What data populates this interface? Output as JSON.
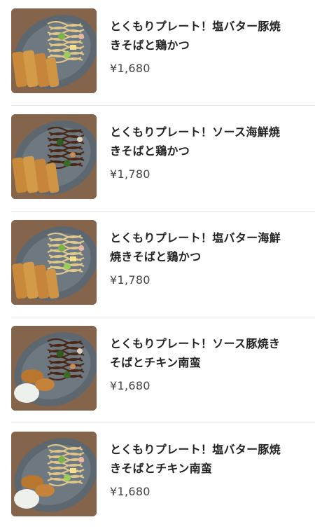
{
  "menu": {
    "items": [
      {
        "name": "とくもりプレート！塩バター豚焼きそばと鶏かつ",
        "price": "¥1,680",
        "image": "shio-butter-pork-yakisoba-chicken-katsu",
        "noodle": "#e2c98c",
        "side": "katsu"
      },
      {
        "name": "とくもりプレート！ソース海鮮焼きそばと鶏かつ",
        "price": "¥1,780",
        "image": "sauce-seafood-yakisoba-chicken-katsu",
        "noodle": "#4a2410",
        "side": "katsu"
      },
      {
        "name": "とくもりプレート！塩バター海鮮焼きそばと鶏かつ",
        "price": "¥1,780",
        "image": "shio-butter-seafood-yakisoba-chicken-katsu",
        "noodle": "#e4cb8e",
        "side": "katsu"
      },
      {
        "name": "とくもりプレート！ソース豚焼きそばとチキン南蛮",
        "price": "¥1,680",
        "image": "sauce-pork-yakisoba-chicken-nanban",
        "noodle": "#4a2410",
        "side": "nanban"
      },
      {
        "name": "とくもりプレート！塩バター豚焼きそばとチキン南蛮",
        "price": "¥1,680",
        "image": "shio-butter-pork-yakisoba-chicken-nanban",
        "noodle": "#e2c98c",
        "side": "nanban"
      }
    ]
  }
}
